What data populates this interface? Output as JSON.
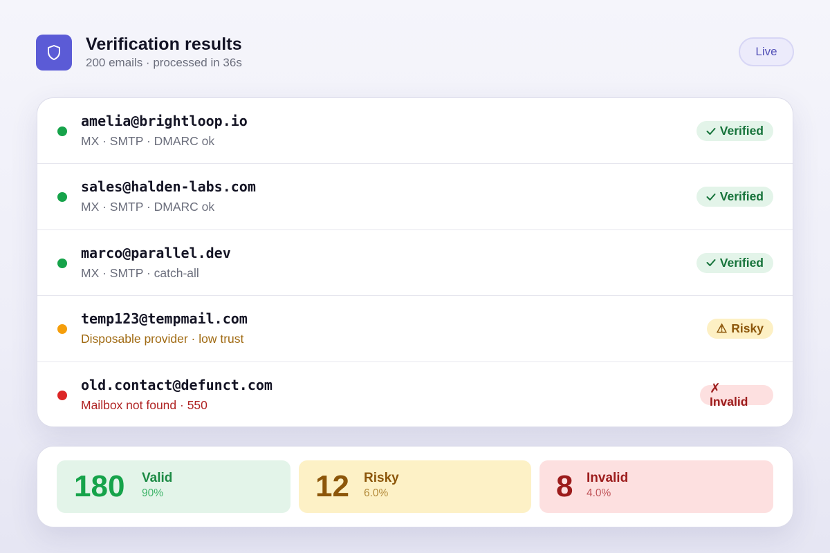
{
  "header": {
    "title": "Verification results",
    "subtitle": "200 emails · processed in 36s",
    "status_pill": "Live",
    "logo_icon": "shield-icon",
    "accent": "#5b5bd6"
  },
  "results": [
    {
      "email": "amelia@brightloop.io",
      "detail": "MX · SMTP · DMARC ok",
      "status": "Verified",
      "icon": "check-icon",
      "dot_color": "#16a34a"
    },
    {
      "email": "sales@halden-labs.com",
      "detail": "MX · SMTP · DMARC ok",
      "status": "Verified",
      "icon": "check-icon",
      "dot_color": "#16a34a"
    },
    {
      "email": "marco@parallel.dev",
      "detail": "MX · SMTP · catch-all",
      "status": "Verified",
      "icon": "check-icon",
      "dot_color": "#16a34a"
    },
    {
      "email": "temp123@tempmail.com",
      "detail": "Disposable provider · low trust",
      "status": "Risky",
      "icon": "warning-icon",
      "icon_glyph": "⚠",
      "dot_color": "#f59e0b"
    },
    {
      "email": "old.contact@defunct.com",
      "detail": "Mailbox not found · 550",
      "status": "Invalid",
      "icon": "x-icon",
      "icon_glyph": "✗",
      "dot_color": "#dc2626"
    }
  ],
  "summary": {
    "valid": {
      "count": "180",
      "label": "Valid",
      "percent": "90%",
      "color": "#16a34a"
    },
    "risky": {
      "count": "12",
      "label": "Risky",
      "percent": "6.0%",
      "color": "#8c560a"
    },
    "invalid": {
      "count": "8",
      "label": "Invalid",
      "percent": "4.0%",
      "color": "#9c1c1c"
    }
  }
}
